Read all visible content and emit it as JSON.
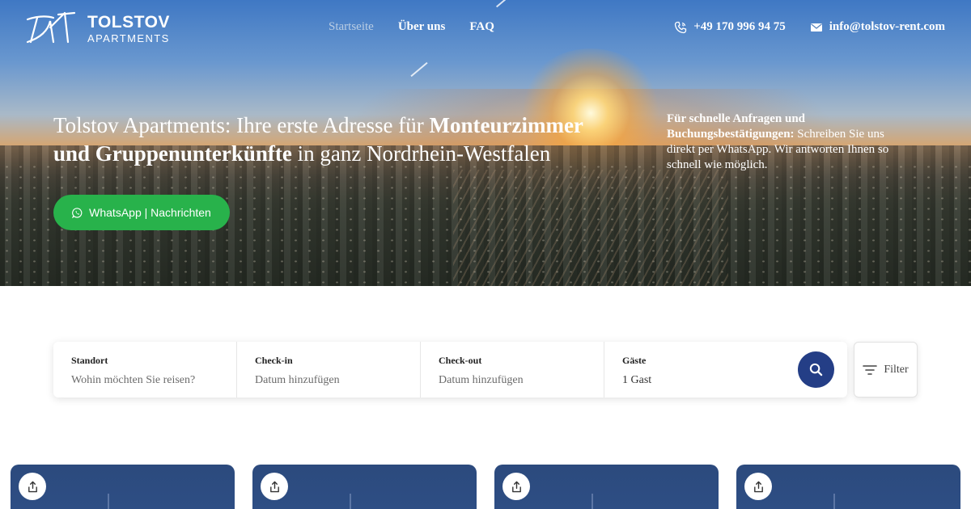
{
  "brand": {
    "name": "TOLSTOV",
    "subtitle": "APARTMENTS",
    "white": "#ffffff"
  },
  "nav": {
    "items": [
      {
        "label": "Startseite",
        "active": true
      },
      {
        "label": "Über uns",
        "active": false
      },
      {
        "label": "FAQ",
        "active": false
      }
    ]
  },
  "contact": {
    "phone": "+49 170 996 94 75",
    "phone_icon": "phone-icon",
    "email": "info@tolstov-rent.com",
    "email_icon": "envelope-icon"
  },
  "hero": {
    "headline_pre": "Tolstov Apartments: Ihre erste Adresse für ",
    "headline_bold": "Monteurzimmer und Gruppenunterkünfte",
    "headline_post": " in ganz Nordrhein-Westfalen",
    "note_bold": "Für schnelle Anfragen und Buchungsbestätigungen:",
    "note_text": " Schreiben Sie uns direkt per WhatsApp. Wir antworten Ihnen so schnell wie möglich.",
    "cta_label": "WhatsApp | Nachrichten",
    "cta_icon": "whatsapp-icon",
    "cta_color": "#28b24b"
  },
  "search": {
    "fields": [
      {
        "label": "Standort",
        "value": "Wohin möchten Sie reisen?"
      },
      {
        "label": "Check-in",
        "value": "Datum hinzufügen"
      },
      {
        "label": "Check-out",
        "value": "Datum hinzufügen"
      },
      {
        "label": "Gäste",
        "value": "1 Gast"
      }
    ],
    "button_icon": "search-icon",
    "button_color": "#243e86",
    "filter_label": "Filter",
    "filter_icon": "filter-icon"
  },
  "listings": {
    "share_icon": "share-icon",
    "card_color": "#2e4f86",
    "count_visible": 4
  }
}
